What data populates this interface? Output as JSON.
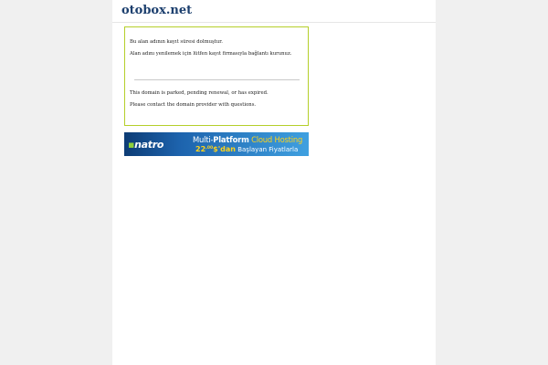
{
  "header": {
    "site_title": "otobox.net"
  },
  "notice": {
    "line1": "Bu alan adının kayıt süresi dolmuştur.",
    "line2": "Alan adını yenilemek için lütfen kayıt firmasıyla bağlantı kurunuz.",
    "line3": "This domain is parked, pending renewal, or has expired.",
    "line4": "Please contact the domain provider with questions."
  },
  "banner": {
    "logo_text": "natro",
    "headline_part1": "Multi-",
    "headline_part2": "Platform",
    "headline_part3": "Cloud Hosting",
    "price_main": "22",
    "price_decimal": ",00",
    "price_suffix": "$'dan",
    "tagline": "Başlayan Fiyatlarla",
    "colors": {
      "bg_dark": "#0d3c75",
      "bg_light": "#3fa0e0",
      "accent": "#ffd31a",
      "logo_dot": "#8ed13b"
    }
  },
  "colors": {
    "page_bg": "#f0f0f0",
    "content_bg": "#ffffff",
    "title_color": "#1c3f6e",
    "notice_border": "#b5cf2a"
  }
}
